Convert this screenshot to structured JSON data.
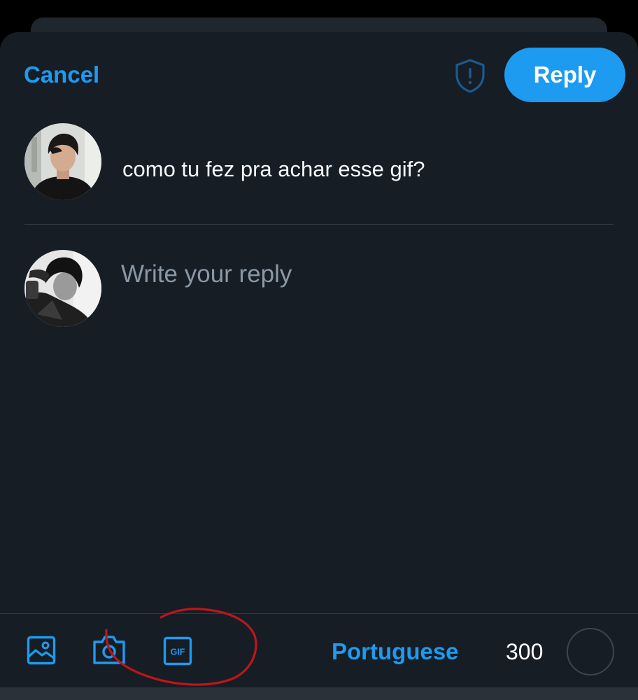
{
  "header": {
    "cancel_label": "Cancel",
    "shield_icon": "shield-exclamation-icon",
    "reply_label": "Reply"
  },
  "original_tweet": {
    "text": "como tu fez pra achar esse gif?"
  },
  "compose": {
    "placeholder": "Write your reply",
    "value": ""
  },
  "toolbar": {
    "icons": [
      "image-icon",
      "camera-icon",
      "gif-icon"
    ],
    "gif_label": "GIF",
    "language": "Portuguese",
    "char_count": "300"
  },
  "colors": {
    "accent": "#1d9bf0",
    "background": "#161d25",
    "annotation": "#c0141b"
  }
}
